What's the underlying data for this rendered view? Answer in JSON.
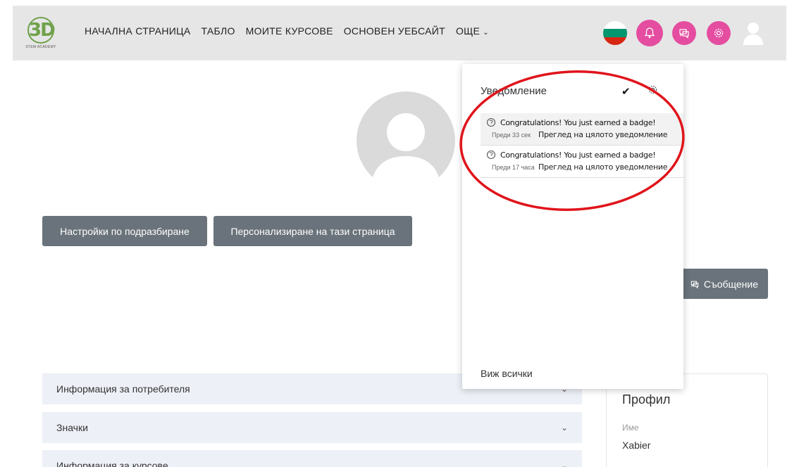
{
  "brand": {
    "logo_mark": "3D",
    "logo_sub": "STEM ACADEMY"
  },
  "nav": {
    "items": [
      {
        "label": "НАЧАЛНА СТРАНИЦА"
      },
      {
        "label": "ТАБЛО"
      },
      {
        "label": "МОИТЕ КУРСОВЕ"
      },
      {
        "label": "ОСНОВЕН УЕБСАЙТ"
      },
      {
        "label": "ОЩЕ"
      }
    ],
    "icons": [
      "bulgaria-flag-icon",
      "bell-icon",
      "chat-icon",
      "gear-icon",
      "user-avatar-icon"
    ]
  },
  "buttons": {
    "defaults": "Настройки по подразбиране",
    "customize": "Персонализиране на тази страница",
    "message": "Съобщение"
  },
  "sections": [
    {
      "label": "Информация за потребителя"
    },
    {
      "label": "Значки"
    },
    {
      "label": "Информация за курсове"
    }
  ],
  "profile": {
    "title": "Профил",
    "name_label": "Име",
    "name_value": "Xabier"
  },
  "notifications": {
    "title": "Уведомление",
    "items": [
      {
        "message": "Congratulations! You just earned a badge!",
        "time": "Преди 33 сек",
        "view": "Преглед на цялото уведомление"
      },
      {
        "message": "Congratulations! You just earned a badge!",
        "time": "Преди 17 часа",
        "view": "Преглед на цялото уведомление"
      }
    ],
    "view_all": "Виж всички"
  },
  "colors": {
    "accent_pink": "#e44da0",
    "button_gray": "#6a737b",
    "annotation_red": "#e0141b",
    "flag_white": "#ffffff",
    "flag_green": "#00966e",
    "flag_red": "#d62612"
  }
}
